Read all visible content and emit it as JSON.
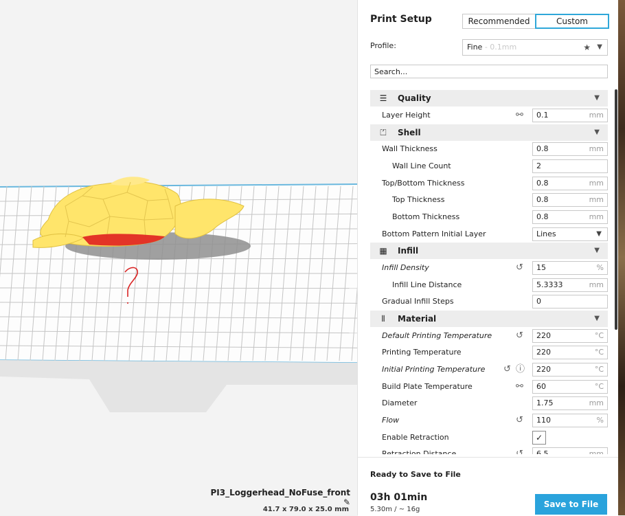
{
  "viewport": {
    "model_name": "PI3_Loggerhead_NoFuse_front",
    "model_dimensions": "41.7 x 79.0 x 25.0 mm",
    "edit_icon": "pencil-icon",
    "annotation": "?"
  },
  "print_setup": {
    "title": "Print Setup",
    "mode_recommended": "Recommended",
    "mode_custom": "Custom",
    "profile_label": "Profile:",
    "profile_value": "Fine",
    "profile_sub": " - 0.1mm",
    "search_placeholder": "Search..."
  },
  "categories": {
    "quality": "Quality",
    "shell": "Shell",
    "infill": "Infill",
    "material": "Material"
  },
  "settings": {
    "layer_height": {
      "label": "Layer Height",
      "value": "0.1",
      "unit": "mm"
    },
    "wall_thickness": {
      "label": "Wall Thickness",
      "value": "0.8",
      "unit": "mm"
    },
    "wall_line_count": {
      "label": "Wall Line Count",
      "value": "2"
    },
    "top_bottom_thickness": {
      "label": "Top/Bottom Thickness",
      "value": "0.8",
      "unit": "mm"
    },
    "top_thickness": {
      "label": "Top Thickness",
      "value": "0.8",
      "unit": "mm"
    },
    "bottom_thickness": {
      "label": "Bottom Thickness",
      "value": "0.8",
      "unit": "mm"
    },
    "bottom_pattern": {
      "label": "Bottom Pattern Initial Layer",
      "value": "Lines"
    },
    "infill_density": {
      "label": "Infill Density",
      "value": "15",
      "unit": "%"
    },
    "infill_line_distance": {
      "label": "Infill Line Distance",
      "value": "5.3333",
      "unit": "mm"
    },
    "gradual_infill_steps": {
      "label": "Gradual Infill Steps",
      "value": "0"
    },
    "default_printing_temperature": {
      "label": "Default Printing Temperature",
      "value": "220",
      "unit": "°C"
    },
    "printing_temperature": {
      "label": "Printing Temperature",
      "value": "220",
      "unit": "°C"
    },
    "initial_printing_temperature": {
      "label": "Initial Printing Temperature",
      "value": "220",
      "unit": "°C"
    },
    "build_plate_temperature": {
      "label": "Build Plate Temperature",
      "value": "60",
      "unit": "°C"
    },
    "diameter": {
      "label": "Diameter",
      "value": "1.75",
      "unit": "mm"
    },
    "flow": {
      "label": "Flow",
      "value": "110",
      "unit": "%"
    },
    "enable_retraction": {
      "label": "Enable Retraction",
      "checked": true
    },
    "retraction_distance": {
      "label": "Retraction Distance",
      "value": "6.5",
      "unit": "mm"
    }
  },
  "footer": {
    "status": "Ready to Save to File",
    "print_time": "03h 01min",
    "material_usage": "5.30m / ~ 16g",
    "save_label": "Save to File"
  },
  "colors": {
    "accent": "#2aa3dc",
    "model": "#ffe56b",
    "overhang": "#e02020",
    "annotation": "#d92424"
  }
}
